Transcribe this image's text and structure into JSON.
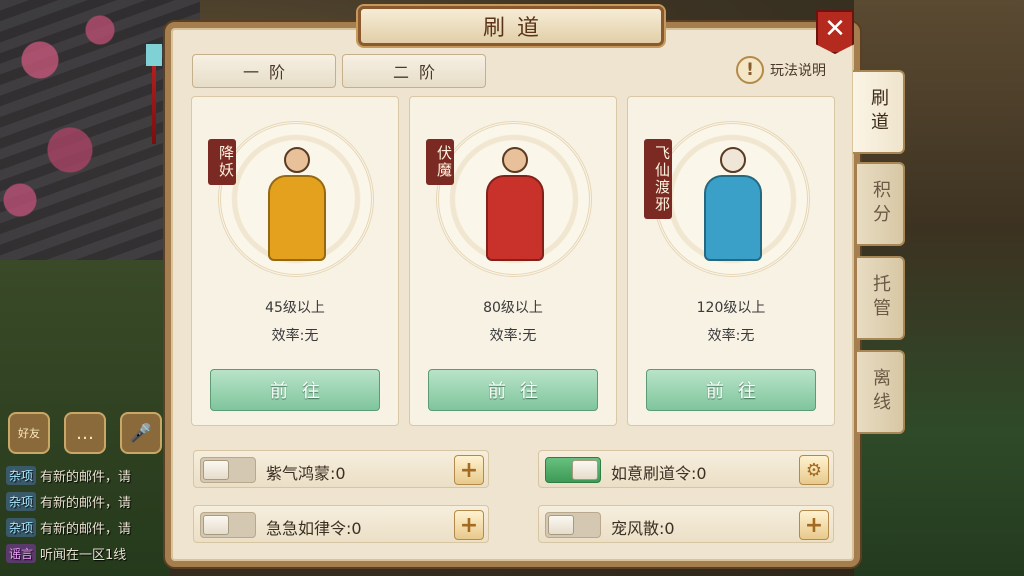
{
  "panel": {
    "title": "刷道",
    "close_symbol": "✕"
  },
  "tier_tabs": [
    {
      "label": "一阶"
    },
    {
      "label": "二阶"
    }
  ],
  "help": {
    "icon": "!",
    "label": "玩法说明"
  },
  "side_tabs": [
    {
      "label": "刷道"
    },
    {
      "label": "积分"
    },
    {
      "label": "托管"
    },
    {
      "label": "离线"
    }
  ],
  "cards": [
    {
      "badge": "降妖",
      "level": "45级以上",
      "efficiency": "效率:无",
      "button": "前往",
      "robe_color": "#e4a11e"
    },
    {
      "badge": "伏魔",
      "level": "80级以上",
      "efficiency": "效率:无",
      "button": "前往",
      "robe_color": "#c8322a"
    },
    {
      "badge": "飞仙渡邪",
      "level": "120级以上",
      "efficiency": "效率:无",
      "button": "前往",
      "robe_color": "#3aa0c8"
    }
  ],
  "options": [
    {
      "label": "紫气鸿蒙:0",
      "toggle": "off",
      "button": "+"
    },
    {
      "label": "如意刷道令:0",
      "toggle": "on",
      "button": "⚙"
    },
    {
      "label": "急急如律令:0",
      "toggle": "off",
      "button": "+"
    },
    {
      "label": "宠风散:0",
      "toggle": "off",
      "button": "+"
    }
  ],
  "chat": {
    "icons": [
      {
        "name": "friend-icon",
        "label": "好友"
      },
      {
        "name": "chat-bubble-icon",
        "label": "…"
      },
      {
        "name": "microphone-icon",
        "label": "🎤"
      }
    ],
    "lines": [
      {
        "tag": "杂项",
        "text": "有新的邮件，请"
      },
      {
        "tag": "杂项",
        "text": "有新的邮件，请"
      },
      {
        "tag": "杂项",
        "text": "有新的邮件，请"
      },
      {
        "tag": "谣言",
        "text": "听闻在一区1线"
      }
    ]
  }
}
